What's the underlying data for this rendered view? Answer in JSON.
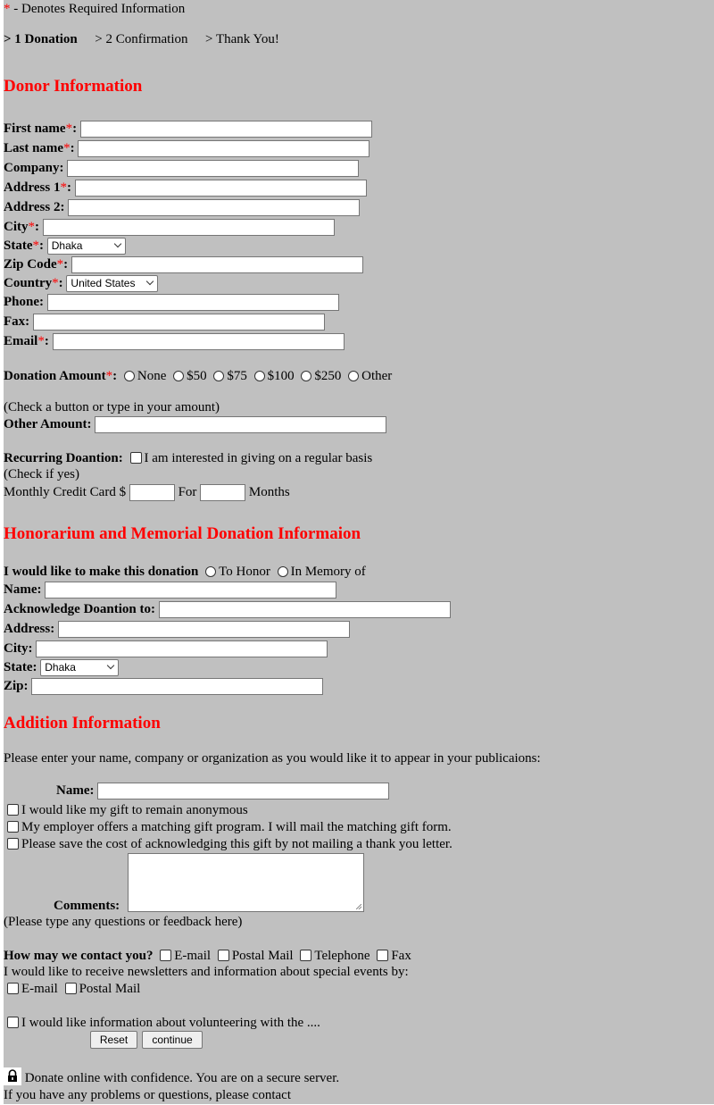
{
  "legend": {
    "asterisk": "*",
    "text": " - Denotes Required Information"
  },
  "steps": [
    {
      "label": "> 1 Donation",
      "active": true
    },
    {
      "label": "> 2 Confirmation",
      "active": false
    },
    {
      "label": "> Thank You!",
      "active": false
    }
  ],
  "donor": {
    "heading": "Donor Information",
    "first_name": "First name",
    "last_name": "Last name",
    "company": "Company:",
    "address1": "Address 1",
    "address2": "Address 2:",
    "city": "City",
    "state": "State",
    "state_value": "Dhaka",
    "zip": "Zip Code",
    "country": "Country",
    "country_value": "United States",
    "phone": "Phone:",
    "fax": "Fax:",
    "email": "Email"
  },
  "donation": {
    "label": "Donation Amount",
    "options": [
      "None",
      "$50",
      "$75",
      "$100",
      "$250",
      "Other"
    ],
    "hint": "(Check a button or type in your amount)",
    "other_label": "Other Amount:"
  },
  "recurring": {
    "label": "Recurring Doantion:",
    "checkbox_text": "I am interested in giving on a regular basis",
    "hint": "(Check if yes)",
    "monthly_label": "Monthly Credit Card $",
    "for_label": "For",
    "months_label": "Months"
  },
  "honor": {
    "heading": "Honorarium and Memorial Donation Informaion",
    "prompt": "I would like to make this donation",
    "opt_honor": "To Honor",
    "opt_memory": "In Memory of",
    "name": "Name:",
    "acknowledge": "Acknowledge Doantion to:",
    "address": "Address:",
    "city": "City:",
    "state": "State:",
    "state_value": "Dhaka",
    "zip": "Zip:"
  },
  "additional": {
    "heading": "Addition Information",
    "instruction": "Please enter your name, company or organization as you would like it to appear in your publicaions:",
    "name": "Name:",
    "anonymous": "I would like my gift to remain anonymous",
    "matching": "My employer offers a matching gift program. I will mail the matching gift form.",
    "no_thanks": "Please save the cost of acknowledging this gift by not mailing a thank you letter.",
    "comments": "Comments:",
    "comments_hint": "(Please type any questions or feedback here)"
  },
  "contact": {
    "label": "How may we contact you?",
    "options": [
      "E-mail",
      "Postal Mail",
      "Telephone",
      "Fax"
    ],
    "newsletter_text": "I would like to receive newsletters and information about special events by:",
    "newsletter_options": [
      "E-mail",
      "Postal Mail"
    ],
    "volunteer": "I would like information about volunteering with the ...."
  },
  "buttons": {
    "reset": "Reset",
    "continue": "continue"
  },
  "footer": {
    "secure": "Donate online with confidence. You are on a secure server.",
    "problems": "If you have any problems or questions, please contact"
  }
}
